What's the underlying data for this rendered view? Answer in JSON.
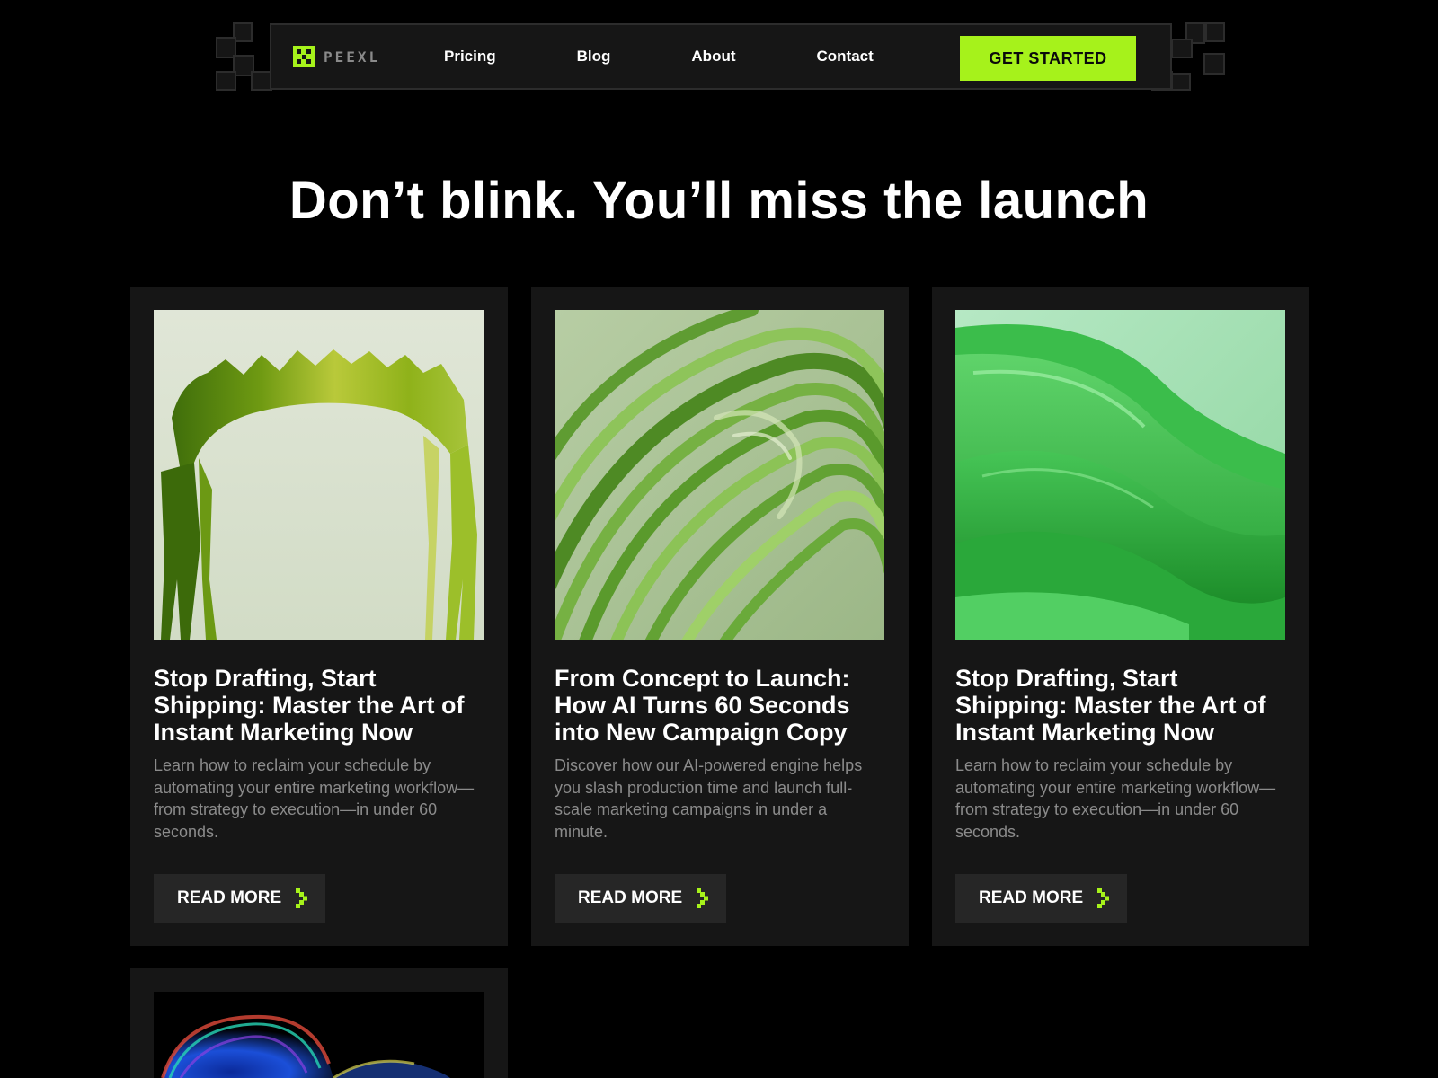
{
  "colors": {
    "background": "#000000",
    "card": "#161616",
    "accent": "#a6f21b",
    "muted_text": "#8b8b8b",
    "button_bg": "#262626"
  },
  "nav": {
    "logo_text": "PEEXL",
    "links": [
      "Pricing",
      "Blog",
      "About",
      "Contact"
    ],
    "cta_label": "GET STARTED"
  },
  "hero": {
    "headline": "Don’t blink. You’ll miss the launch"
  },
  "posts": [
    {
      "image": "green-dripping-ring-artwork",
      "title": "Stop Drafting, Start Shipping: Master the Art of Instant Marketing Now",
      "description": "Learn how to reclaim your schedule by automating your entire marketing workflow—from strategy to execution—in under 60 seconds.",
      "button_label": "READ MORE",
      "button_icon": "pixel-chevron-right-icon"
    },
    {
      "image": "green-ribbed-swirl-artwork",
      "title": "From Concept to Launch: How AI Turns 60 Seconds into New Campaign Copy",
      "description": "Discover how our AI-powered engine helps you slash production time and launch full-scale marketing campaigns in under a minute.",
      "button_label": "READ MORE",
      "button_icon": "pixel-chevron-right-icon"
    },
    {
      "image": "green-glossy-waves-artwork",
      "title": "Stop Drafting, Start Shipping: Master the Art of Instant Marketing Now",
      "description": "Learn how to reclaim your schedule by automating your entire marketing workflow—from strategy to execution—in under 60 seconds.",
      "button_label": "READ MORE",
      "button_icon": "pixel-chevron-right-icon"
    },
    {
      "image": "iridescent-blue-blob-artwork"
    }
  ]
}
